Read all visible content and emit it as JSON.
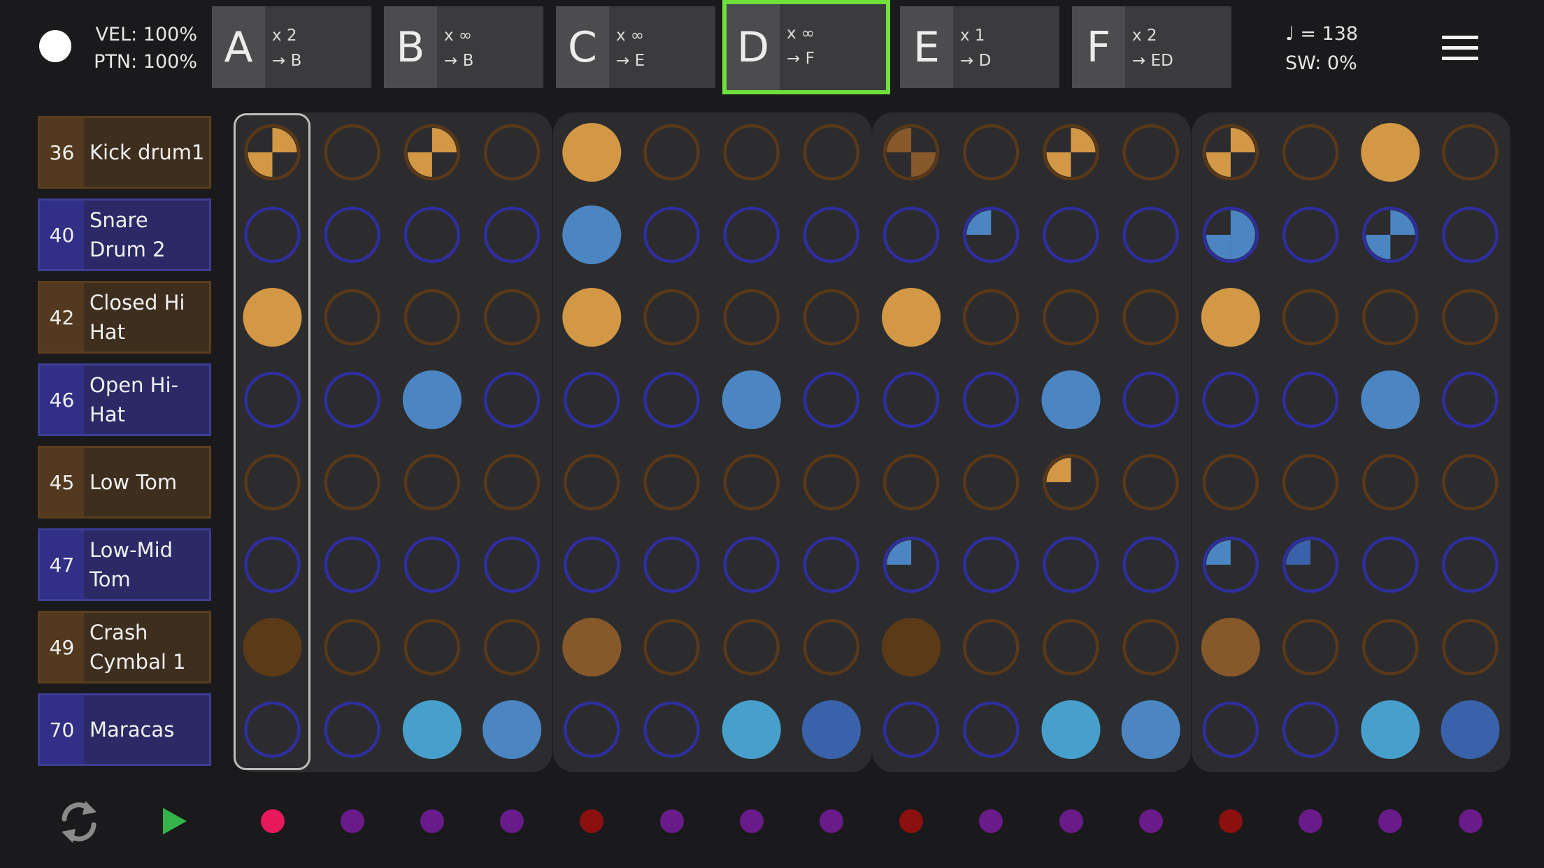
{
  "status": {
    "velocity": "VEL: 100%",
    "pattern_velocity": "PTN: 100%"
  },
  "patterns": [
    {
      "letter": "A",
      "repeat": "x 2",
      "next": "→ B",
      "active": false
    },
    {
      "letter": "B",
      "repeat": "x ∞",
      "next": "→ B",
      "active": false
    },
    {
      "letter": "C",
      "repeat": "x ∞",
      "next": "→ E",
      "active": false
    },
    {
      "letter": "D",
      "repeat": "x ∞",
      "next": "→ F",
      "active": true
    },
    {
      "letter": "E",
      "repeat": "x 1",
      "next": "→ D",
      "active": false
    },
    {
      "letter": "F",
      "repeat": "x 2",
      "next": "→ ED",
      "active": false
    }
  ],
  "tempo": {
    "bpm": "♩ = 138",
    "swing": "SW: 0%"
  },
  "icons": {
    "record": "record-dot-icon",
    "menu": "hamburger-menu-icon",
    "loop": "loop-icon",
    "play": "play-icon"
  },
  "colors": {
    "orange": "#d39845",
    "orange_ring": "#5a3818",
    "orange_dark": "#5c3a17",
    "orange_mid": "#87592a",
    "blue": "#4b86c3",
    "blue_ring": "#2f2ea0",
    "light_blue": "#47a0cc",
    "deep_blue": "#3a62aa",
    "active_pattern": "#6fe03c",
    "play": "#33b34a",
    "step_current": "#e8185c",
    "step_purple": "#6a1b8a",
    "step_red": "#8c1010"
  },
  "tracks": [
    {
      "note": "36",
      "name": "Kick drum1",
      "color": "orange",
      "steps": [
        "q2",
        "e",
        "q2",
        "e",
        "f",
        "e",
        "e",
        "e",
        "q2d",
        "e",
        "q2",
        "e",
        "q2",
        "e",
        "f",
        "e"
      ]
    },
    {
      "note": "40",
      "name": "Snare Drum 2",
      "color": "blue",
      "steps": [
        "e",
        "e",
        "e",
        "e",
        "f",
        "e",
        "e",
        "e",
        "e",
        "q1",
        "e",
        "e",
        "q3",
        "e",
        "q2",
        "e"
      ]
    },
    {
      "note": "42",
      "name": "Closed Hi Hat",
      "color": "orange",
      "steps": [
        "f",
        "e",
        "e",
        "e",
        "f",
        "e",
        "e",
        "e",
        "f",
        "e",
        "e",
        "e",
        "f",
        "e",
        "e",
        "e"
      ]
    },
    {
      "note": "46",
      "name": "Open Hi-Hat",
      "color": "blue",
      "steps": [
        "e",
        "e",
        "f",
        "e",
        "e",
        "e",
        "f",
        "e",
        "e",
        "e",
        "f",
        "e",
        "e",
        "e",
        "f",
        "e"
      ]
    },
    {
      "note": "45",
      "name": "Low Tom",
      "color": "orange",
      "steps": [
        "e",
        "e",
        "e",
        "e",
        "e",
        "e",
        "e",
        "e",
        "e",
        "e",
        "q1",
        "e",
        "e",
        "e",
        "e",
        "e"
      ]
    },
    {
      "note": "47",
      "name": "Low-Mid Tom",
      "color": "blue",
      "steps": [
        "e",
        "e",
        "e",
        "e",
        "e",
        "e",
        "e",
        "e",
        "q1",
        "e",
        "e",
        "e",
        "q1",
        "q1d",
        "e",
        "e"
      ]
    },
    {
      "note": "49",
      "name": "Crash Cymbal 1",
      "color": "orange",
      "steps": [
        "fd",
        "e",
        "e",
        "e",
        "fm",
        "e",
        "e",
        "e",
        "fd",
        "e",
        "e",
        "e",
        "fm",
        "e",
        "e",
        "e"
      ]
    },
    {
      "note": "70",
      "name": "Maracas",
      "color": "blue",
      "steps": [
        "e",
        "e",
        "fl",
        "f",
        "e",
        "e",
        "fl",
        "fdb",
        "e",
        "e",
        "fl",
        "f",
        "e",
        "e",
        "fl",
        "fdb"
      ]
    }
  ],
  "step_indicators": [
    "current",
    "off",
    "off",
    "off",
    "bar",
    "off",
    "off",
    "off",
    "bar",
    "off",
    "off",
    "off",
    "bar",
    "off",
    "off",
    "off"
  ]
}
